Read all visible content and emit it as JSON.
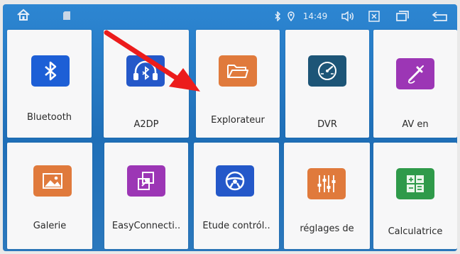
{
  "status_bar": {
    "home_icon": "home-icon",
    "sd_icon": "sd-card-icon",
    "bluetooth_icon": "bluetooth-icon",
    "location_icon": "location-icon",
    "time": "14:49",
    "volume_icon": "volume-icon",
    "close_icon": "close-icon",
    "window_icon": "window-icon",
    "back_icon": "back-icon"
  },
  "apps": [
    {
      "label": "Bluetooth",
      "icon": "bluetooth-icon",
      "color": "#1d5fd6"
    },
    {
      "label": "A2DP",
      "icon": "headphones-icon",
      "color": "#2458c9"
    },
    {
      "label": "Explorateur",
      "icon": "folder-icon",
      "color": "#e07a3c"
    },
    {
      "label": "DVR",
      "icon": "speedometer-icon",
      "color": "#1d5577"
    },
    {
      "label": "AV en",
      "icon": "av-cable-icon",
      "color": "#9c36b5"
    },
    {
      "label": "Galerie",
      "icon": "gallery-icon",
      "color": "#e07a3c"
    },
    {
      "label": "EasyConnecti..",
      "icon": "easyconnect-icon",
      "color": "#9c36b5"
    },
    {
      "label": "Étude contról..",
      "icon": "steering-wheel-icon",
      "color": "#2458c9"
    },
    {
      "label": "réglages de",
      "icon": "equalizer-icon",
      "color": "#e07a3c"
    },
    {
      "label": "Calculatrice",
      "icon": "calculator-icon",
      "color": "#2f9a4a"
    }
  ],
  "annotation": {
    "arrow_color": "#ec1c1c",
    "arrow_icon": "pointer-arrow"
  }
}
